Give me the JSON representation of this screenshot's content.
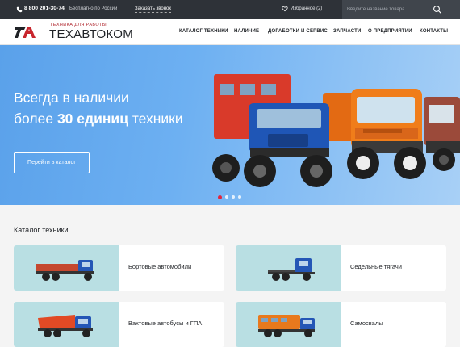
{
  "topbar": {
    "phone": "8 800 201-30-74",
    "phone_note": "Бесплатно по России",
    "callback": "Заказать звонок",
    "favorites": "Избранное (2)",
    "search_placeholder": "Введите название товара"
  },
  "header": {
    "logo_tagline": "ТЕХНИКА ДЛЯ РАБОТЫ",
    "logo_name": "ТЕХАВТОКОМ",
    "nav": [
      "КАТАЛОГ ТЕХНИКИ",
      "НАЛИЧИЕ",
      "ДОРАБОТКИ И СЕРВИС",
      "ЗАПЧАСТИ",
      "О ПРЕДПРИЯТИИ",
      "КОНТАКТЫ"
    ]
  },
  "hero": {
    "line1": "Всегда в наличии",
    "line2_prefix": "более",
    "line2_bold": "30 единиц",
    "line2_suffix": "техники",
    "button": "Перейти в каталог",
    "slides_total": 4,
    "slide_active": 1
  },
  "catalog": {
    "title": "Каталог техники",
    "items": [
      {
        "label": "Бортовые автомобили",
        "icon": "flatbed-truck-icon"
      },
      {
        "label": "Седельные тягачи",
        "icon": "tractor-unit-icon"
      },
      {
        "label": "Вахтовые автобусы и ГПА",
        "icon": "crew-bus-icon"
      },
      {
        "label": "Самосвалы",
        "icon": "dump-truck-icon"
      }
    ]
  },
  "colors": {
    "topbar": "#2e3238",
    "accent": "#e4243c",
    "hero_blue": "#5aa1ea",
    "card_thumb": "#b9dfe3"
  }
}
